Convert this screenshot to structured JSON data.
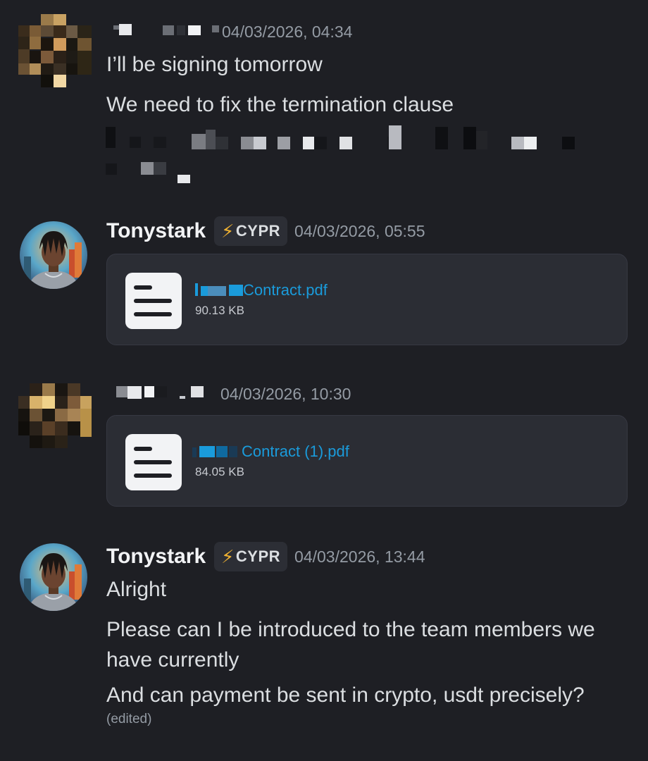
{
  "messages": [
    {
      "author": "",
      "timestamp": "04/03/2026, 04:34",
      "lines": [
        "I’ll be signing tomorrow",
        "We need to fix the termination clause"
      ]
    },
    {
      "author": "Tonystark",
      "tag": "CYPR",
      "timestamp": "04/03/2026, 05:55",
      "attachment": {
        "name": "Contract.pdf",
        "size": "90.13 KB"
      }
    },
    {
      "author": "",
      "timestamp": "04/03/2026, 10:30",
      "attachment": {
        "name": "Contract (1).pdf",
        "size": "84.05 KB"
      }
    },
    {
      "author": "Tonystark",
      "tag": "CYPR",
      "timestamp": "04/03/2026, 13:44",
      "lines": [
        "Alright",
        "Please can I be introduced to the team members we have currently",
        "And can payment be sent in crypto, usdt precisely?"
      ],
      "edited": "(edited)"
    }
  ],
  "icons": {
    "tag_icon": "lightning-bolt-icon",
    "file_icon": "document-file-icon"
  },
  "colors": {
    "background": "#1e1f24",
    "link": "#1a9bdb",
    "tag_bolt": "#f0b232"
  }
}
